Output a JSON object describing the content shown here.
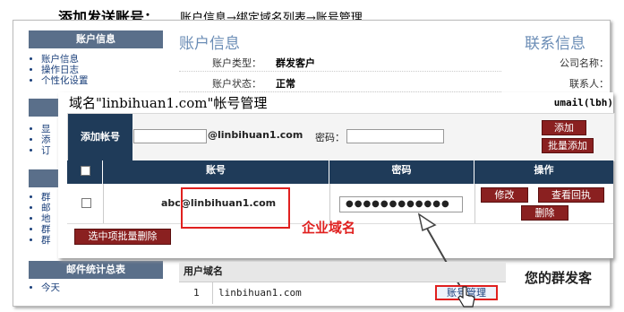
{
  "header": {
    "heading": "添加发送账号：",
    "breadcrumb": "账户信息→绑定域名列表→账号管理"
  },
  "sidebar": {
    "account_info": {
      "title": "账户信息",
      "items": [
        "账户信息",
        "操作日志",
        "个性化设置"
      ]
    },
    "partial_items_1": [
      "显",
      "添",
      "订"
    ],
    "partial_items_2": [
      "群",
      "邮",
      "地",
      "群",
      "群"
    ],
    "stats": {
      "title": "邮件统计总表",
      "items": [
        "今天"
      ]
    }
  },
  "background": {
    "account_title": "账户信息",
    "contact_title": "联系信息",
    "rows": [
      {
        "label": "账户类型：",
        "value": "群发客户"
      },
      {
        "label": "账户状态：",
        "value": "正常"
      }
    ],
    "contact_rows": [
      "公司名称：",
      "联系人："
    ],
    "your_mass_title": "您的群发客",
    "user_domain_table": {
      "header": "用户域名",
      "rows": [
        {
          "num": "1",
          "domain": "linbihuan1.com",
          "action": "账号管理"
        }
      ]
    }
  },
  "overlay": {
    "title": "域名\"linbihuan1.com\"帐号管理",
    "user": "umail(lbh)",
    "add_label": "添加帐号",
    "account_input_value": "",
    "domain_suffix": "@linbihuan1.com",
    "password_label": "密码：",
    "password_input_value": "",
    "add_button": "添加",
    "batch_add_button": "批量添加",
    "table": {
      "headers": [
        "账号",
        "密码",
        "操作"
      ],
      "rows": [
        {
          "account": "abc@linbihuan1.com",
          "password": "●●●●●●●●●●●●",
          "actions": [
            "修改",
            "查看回执",
            "删除"
          ]
        }
      ]
    },
    "batch_delete_button": "选中项批量删除",
    "annotation": "企业域名"
  },
  "colors": {
    "nav_dark": "#1f3b59",
    "sidebar_head": "#5a6f8a",
    "action_red": "#8a2020",
    "annotation_red": "#e0201f",
    "title_blue": "#6b8db6"
  }
}
